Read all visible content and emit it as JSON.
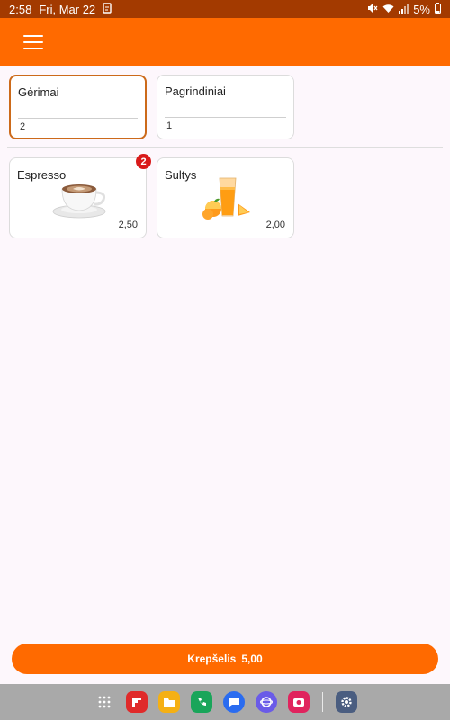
{
  "status_bar": {
    "time": "2:58",
    "date": "Fri, Mar 22",
    "battery": "5%"
  },
  "categories": [
    {
      "name": "Gėrimai",
      "count": "2",
      "selected": true
    },
    {
      "name": "Pagrindiniai",
      "count": "1",
      "selected": false
    }
  ],
  "products": [
    {
      "name": "Espresso",
      "price": "2,50",
      "badge": "2",
      "image": "coffee-cup-image"
    },
    {
      "name": "Sultys",
      "price": "2,00",
      "badge": null,
      "image": "orange-juice-image"
    }
  ],
  "cart": {
    "label": "Krepšelis",
    "total": "5,00"
  },
  "colors": {
    "status_bar": "#a33a00",
    "app_bar": "#ff6a00",
    "accent_border": "#cc6a1a",
    "badge": "#d91a1a",
    "background": "#fdf7fc"
  },
  "dock": [
    "apps-grid-icon",
    "flipboard-icon",
    "files-icon",
    "phone-icon",
    "messages-icon",
    "internet-icon",
    "camera-icon",
    "settings-icon"
  ]
}
